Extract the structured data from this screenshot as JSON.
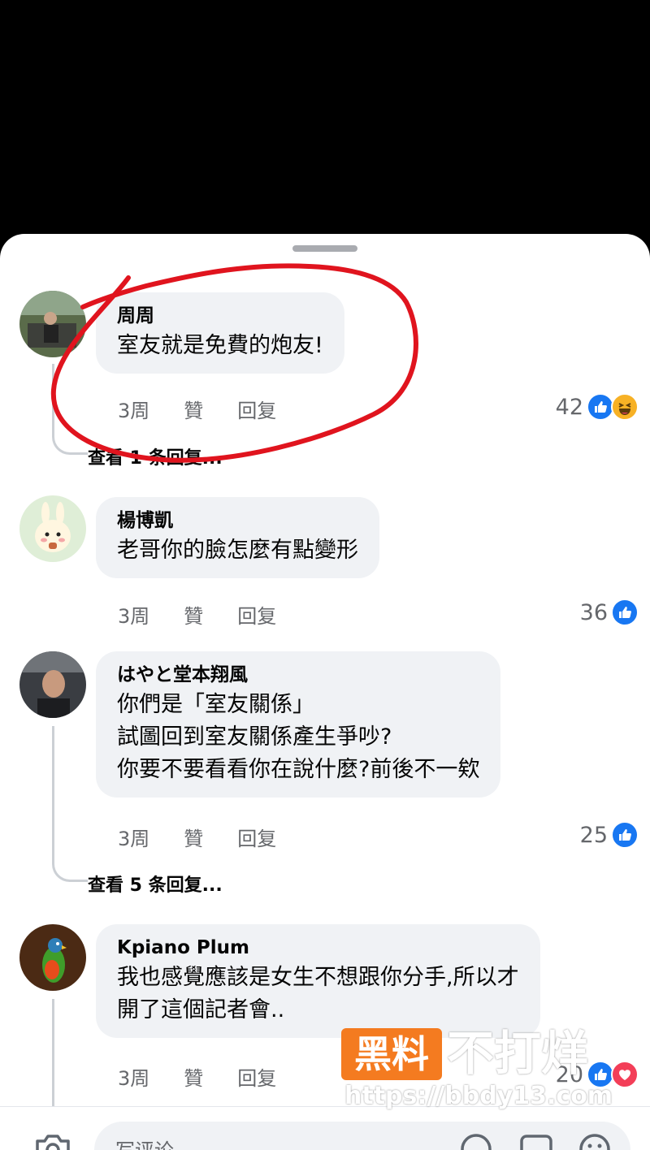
{
  "comments": [
    {
      "author": "周周",
      "lines": [
        "室友就是免費的炮友!"
      ],
      "time": "3周",
      "like": "贊",
      "reply": "回复",
      "reaction_count": "42",
      "reactions": [
        "like-icon",
        "haha-icon"
      ],
      "view_replies": "查看 1 条回复..."
    },
    {
      "author": "楊博凱",
      "lines": [
        "老哥你的臉怎麼有點變形"
      ],
      "time": "3周",
      "like": "贊",
      "reply": "回复",
      "reaction_count": "36",
      "reactions": [
        "like-icon"
      ]
    },
    {
      "author": "はやと堂本翔風",
      "lines": [
        "你們是「室友關係」",
        "試圖回到室友關係產生爭吵?",
        "你要不要看看你在說什麼?前後不一欸"
      ],
      "time": "3周",
      "like": "贊",
      "reply": "回复",
      "reaction_count": "25",
      "reactions": [
        "like-icon"
      ],
      "view_replies": "查看 5 条回复..."
    },
    {
      "author": "Kpiano Plum",
      "lines": [
        "我也感覺應該是女生不想跟你分手,所以才",
        "開了這個記者會.."
      ],
      "time": "3周",
      "like": "贊",
      "reply": "回复",
      "reaction_count": "20",
      "reactions": [
        "like-icon",
        "love-icon"
      ]
    }
  ],
  "composer": {
    "placeholder": "写评论"
  },
  "watermark": {
    "badge": "黑料",
    "text": "不打烊",
    "url": "https://bbdy13.com"
  },
  "colors": {
    "like": "#1877f2",
    "love": "#f33e58",
    "haha": "#f7b125",
    "annotation": "#e0141e",
    "watermark": "#f47b20"
  }
}
